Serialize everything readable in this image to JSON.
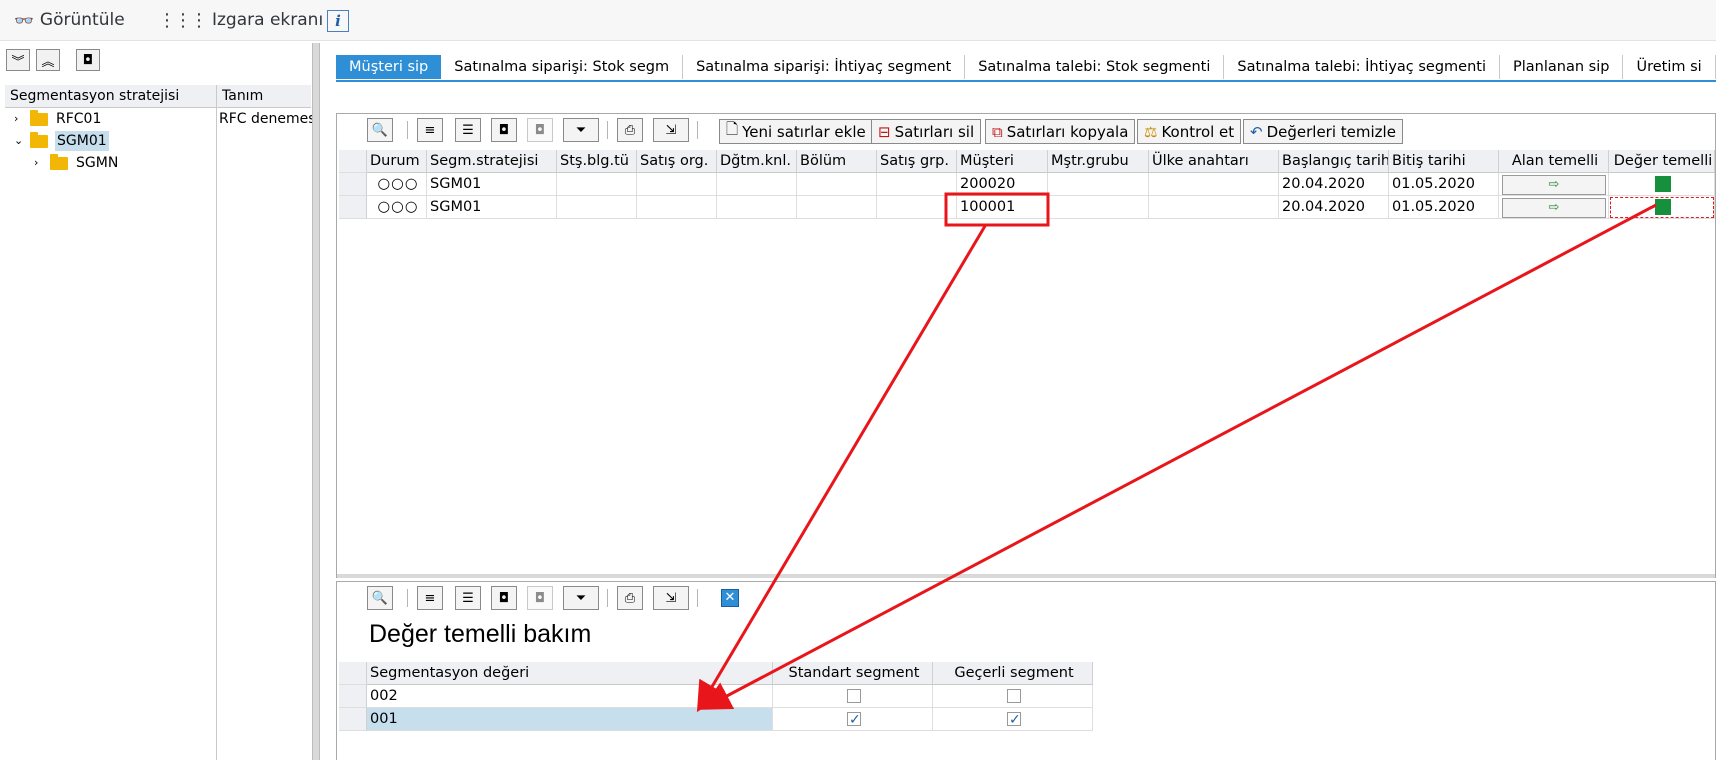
{
  "toolbar": {
    "display_label": "Görüntüle",
    "grid_label": "Izgara ekranı",
    "info_label": "i"
  },
  "left_pane": {
    "header_col1": "Segmentasyon stratejisi",
    "header_col2": "Tanım",
    "tree": [
      {
        "label": "RFC01",
        "desc": "RFC denemes",
        "expanded": false
      },
      {
        "label": "SGM01",
        "desc": "",
        "expanded": true,
        "selected": true
      },
      {
        "label": "SGMN",
        "desc": "",
        "expanded": false
      }
    ]
  },
  "tabs": [
    {
      "label": "Müşteri sip",
      "active": true
    },
    {
      "label": "Satınalma siparişi: Stok segm"
    },
    {
      "label": "Satınalma siparişi: İhtiyaç segment"
    },
    {
      "label": "Satınalma talebi: Stok segmenti"
    },
    {
      "label": "Satınalma talebi: İhtiyaç segmenti"
    },
    {
      "label": "Planlanan sip"
    },
    {
      "label": "Üretim si"
    }
  ],
  "main_toolbar": {
    "add_rows": "Yeni satırlar ekle",
    "delete_rows": "Satırları sil",
    "copy_rows": "Satırları kopyala",
    "check": "Kontrol et",
    "clear_values": "Değerleri temizle"
  },
  "main_grid": {
    "columns": [
      "Durum",
      "Segm.stratejisi",
      "Stş.blg.tü",
      "Satış org.",
      "Dğtm.knl.",
      "Bölüm",
      "Satış grp.",
      "Müşteri",
      "Mştr.grubu",
      "Ülke anahtarı",
      "Başlangıç tarihi",
      "Bitiş tarihi",
      "Alan temelli",
      "Değer temelli"
    ],
    "rows": [
      {
        "status": "○○○",
        "strategy": "SGM01",
        "customer": "200020",
        "start": "20.04.2020",
        "end": "01.05.2020"
      },
      {
        "status": "○○○",
        "strategy": "SGM01",
        "customer": "100001",
        "start": "20.04.2020",
        "end": "01.05.2020"
      }
    ]
  },
  "detail": {
    "title": "Değer temelli bakım",
    "columns": [
      "Segmentasyon değeri",
      "Standart segment",
      "Geçerli segment"
    ],
    "rows": [
      {
        "value": "002",
        "standard": false,
        "valid": false
      },
      {
        "value": "001",
        "standard": true,
        "valid": true
      }
    ]
  },
  "colors": {
    "accent": "#2f8fd6",
    "annotation": "#e8161b",
    "status_green": "#16903c",
    "selected_row": "#c7dfed"
  }
}
